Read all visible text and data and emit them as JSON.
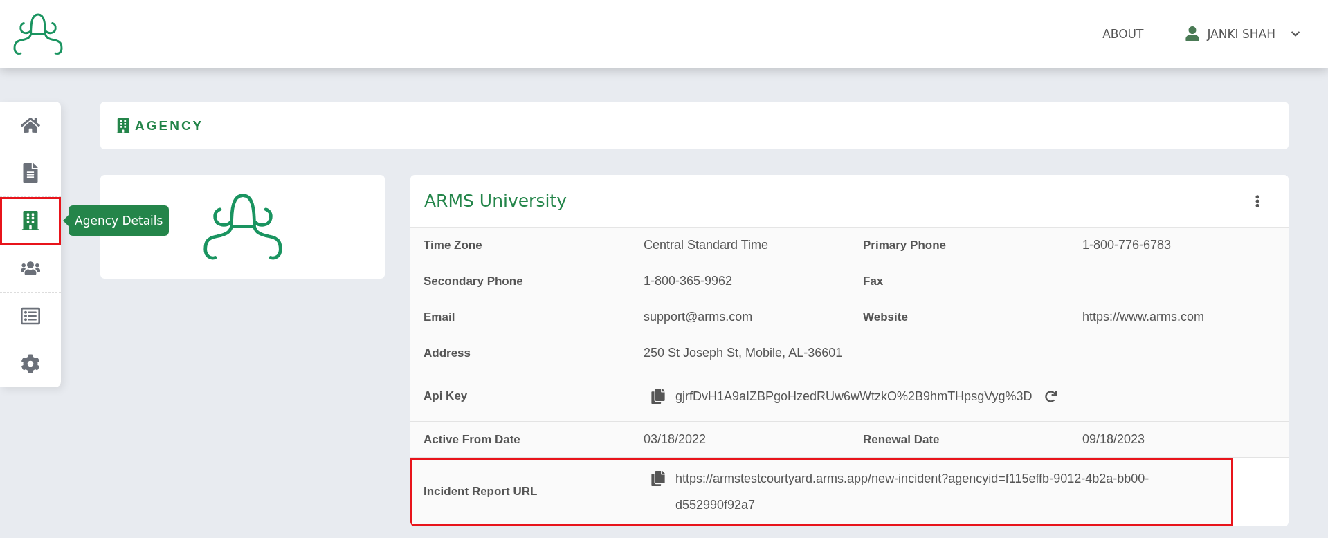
{
  "header": {
    "nav": [
      {
        "label": "ABOUT"
      }
    ],
    "user": {
      "name": "JANKI SHAH"
    }
  },
  "sidebar": {
    "items": [
      {
        "selected": false,
        "highlighted": false
      },
      {
        "selected": false,
        "highlighted": false
      },
      {
        "selected": true,
        "highlighted": true,
        "tooltip": "Agency Details"
      },
      {
        "selected": false,
        "highlighted": false
      },
      {
        "selected": false,
        "highlighted": false
      },
      {
        "selected": false,
        "highlighted": false
      }
    ]
  },
  "page_title": "AGENCY",
  "agency": {
    "name": "ARMS University",
    "rows": [
      {
        "kind": "pairs",
        "highlighted": false,
        "fields": [
          {
            "label": "Time Zone",
            "value": "Central Standard Time"
          },
          {
            "label": "Primary Phone",
            "value": "1-800-776-6783"
          }
        ]
      },
      {
        "kind": "pairs",
        "highlighted": false,
        "fields": [
          {
            "label": "Secondary Phone",
            "value": "1-800-365-9962"
          },
          {
            "label": "Fax"
          }
        ]
      },
      {
        "kind": "pairs",
        "highlighted": false,
        "fields": [
          {
            "label": "Email",
            "value": "support@arms.com"
          },
          {
            "label": "Website",
            "value": "https://www.arms.com"
          }
        ]
      },
      {
        "kind": "wide",
        "highlighted": false,
        "fields": [
          {
            "label": "Address",
            "value": "250 St Joseph St, Mobile, AL-36601"
          }
        ]
      },
      {
        "kind": "key",
        "highlighted": false,
        "fields": [
          {
            "label": "Api Key",
            "value": "gjrfDvH1A9aIZBPgoHzedRUw6wWtzkO%2B9hmTHpsgVyg%3D"
          }
        ]
      },
      {
        "kind": "pairs",
        "highlighted": false,
        "fields": [
          {
            "label": "Active From Date",
            "value": "03/18/2022"
          },
          {
            "label": "Renewal Date",
            "value": "09/18/2023"
          }
        ]
      },
      {
        "kind": "url",
        "highlighted": true,
        "fields": [
          {
            "label": "Incident Report URL",
            "value": "https://armstestcourtyard.arms.app/new-incident?agencyid=f115effb-9012-4b2a-bb00-d552990f92a7"
          }
        ]
      }
    ]
  }
}
